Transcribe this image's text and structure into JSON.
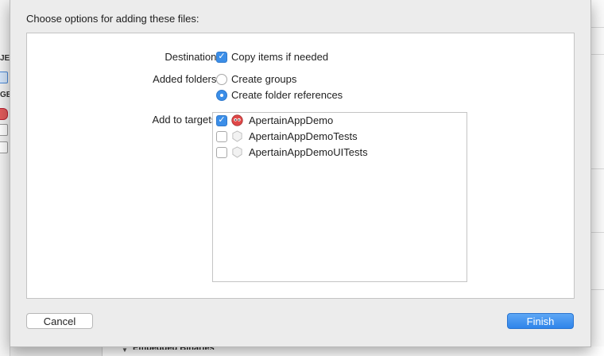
{
  "background": {
    "left_fragments": [
      "JE",
      "GE"
    ],
    "bottom_section": "Embedded Binaries"
  },
  "sheet": {
    "title": "Choose options for adding these files:",
    "destination": {
      "label": "Destination:",
      "option": "Copy items if needed",
      "checked": true
    },
    "added_folders": {
      "label": "Added folders:",
      "options": [
        {
          "label": "Create groups",
          "selected": false
        },
        {
          "label": "Create folder references",
          "selected": true
        }
      ]
    },
    "add_to_targets": {
      "label": "Add to targets:",
      "items": [
        {
          "name": "ApertainAppDemo",
          "checked": true,
          "icon": "app-target-icon"
        },
        {
          "name": "ApertainAppDemoTests",
          "checked": false,
          "icon": "test-target-icon"
        },
        {
          "name": "ApertainAppDemoUITests",
          "checked": false,
          "icon": "test-target-icon"
        }
      ]
    },
    "buttons": {
      "cancel": "Cancel",
      "finish": "Finish"
    }
  },
  "colors": {
    "accent": "#3b8ee8",
    "sheet_bg": "#ececec",
    "panel_bg": "#ffffff"
  }
}
